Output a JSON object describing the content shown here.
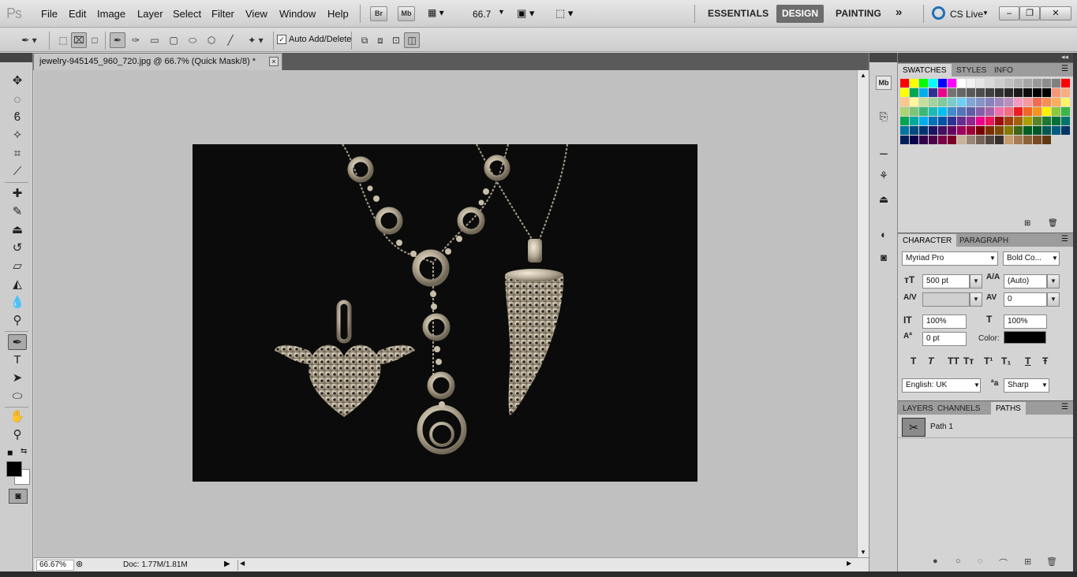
{
  "app": {
    "logo": "Ps",
    "menus": [
      "File",
      "Edit",
      "Image",
      "Layer",
      "Select",
      "Filter",
      "View",
      "Window",
      "Help"
    ],
    "bridge_label": "Br",
    "minibridge_label": "Mb",
    "zoom": "66.7",
    "workspaces": {
      "essentials": "ESSENTIALS",
      "design": "DESIGN",
      "painting": "PAINTING",
      "more": "»"
    },
    "cs_live": "CS Live",
    "window_controls": {
      "minimize": "–",
      "restore": "❐",
      "close": "✕"
    }
  },
  "options": {
    "auto_add_delete_label": "Auto Add/Delete",
    "auto_add_delete_checked": "✓"
  },
  "document": {
    "tab_title": "jewelry-945145_960_720.jpg @ 66.7% (Quick Mask/8) *",
    "close": "×"
  },
  "status": {
    "zoom": "66.67%",
    "doc_info": "Doc: 1.77M/1.81M"
  },
  "swatches_panel": {
    "tabs": [
      "SWATCHES",
      "STYLES",
      "INFO"
    ],
    "colors": [
      "#ff0000",
      "#ffff00",
      "#00ff00",
      "#00ffff",
      "#0000ff",
      "#ff00ff",
      "#ffffff",
      "#f2f2f2",
      "#e6e6e6",
      "#d9d9d9",
      "#cccccc",
      "#bfbfbf",
      "#b3b3b3",
      "#a6a6a6",
      "#999999",
      "#8c8c8c",
      "#808080",
      "#ff0000",
      "#ffff00",
      "#00a651",
      "#00aeef",
      "#2e3192",
      "#ec008c",
      "#737373",
      "#666666",
      "#595959",
      "#4d4d4d",
      "#404040",
      "#333333",
      "#262626",
      "#1a1a1a",
      "#0d0d0d",
      "#000000",
      "#000000",
      "#f7977a",
      "#f9ad81",
      "#fdc68a",
      "#fff79a",
      "#c4df9b",
      "#a3d39c",
      "#82ca9d",
      "#7bcdc8",
      "#6ecff6",
      "#7ea7d8",
      "#8493ca",
      "#8882be",
      "#a187be",
      "#bc8dbf",
      "#f49ac2",
      "#f6989d",
      "#f26c4f",
      "#f68e55",
      "#fbaf5d",
      "#fff467",
      "#acd372",
      "#7cc576",
      "#3bb878",
      "#1abbb4",
      "#00bff3",
      "#438ccb",
      "#5574b9",
      "#605ca8",
      "#855fa8",
      "#a763a8",
      "#f06eaa",
      "#f26d7d",
      "#ed1c24",
      "#f26522",
      "#f7941d",
      "#fff200",
      "#8dc73f",
      "#39b54a",
      "#00a651",
      "#00a99d",
      "#00aeef",
      "#0072bc",
      "#0054a6",
      "#2e3192",
      "#662d91",
      "#92278f",
      "#ec008c",
      "#ed145b",
      "#9e0b0f",
      "#a0410d",
      "#a36209",
      "#aba000",
      "#598527",
      "#1a7b30",
      "#007236",
      "#00746b",
      "#0076a3",
      "#004b80",
      "#003471",
      "#1b1464",
      "#440e62",
      "#630460",
      "#9e005d",
      "#9e0039",
      "#790000",
      "#7b2e00",
      "#7d4900",
      "#827b00",
      "#406618",
      "#005e20",
      "#005826",
      "#005952",
      "#005b7f",
      "#003663",
      "#002157",
      "#0d004c",
      "#32004b",
      "#4b0049",
      "#7b0046",
      "#7a0026",
      "#c7b299",
      "#998675",
      "#736357",
      "#534741",
      "#37302d",
      "#c69c6d",
      "#a67c52",
      "#8c6239",
      "#754c24",
      "#603913"
    ]
  },
  "character_panel": {
    "tabs": [
      "CHARACTER",
      "PARAGRAPH"
    ],
    "font_family": "Myriad Pro",
    "font_style": "Bold Co...",
    "font_size": "500 pt",
    "leading": "(Auto)",
    "kerning": "",
    "tracking": "0",
    "vertical_scale": "100%",
    "horizontal_scale": "100%",
    "baseline_shift": "0 pt",
    "color_label": "Color:",
    "color_value": "#000000",
    "type_buttons": [
      "T",
      "T",
      "TT",
      "Tт",
      "T¹",
      "T₁",
      "T",
      "Ŧ"
    ],
    "language": "English: UK",
    "aa_label": "ªa",
    "antialias": "Sharp"
  },
  "paths_panel": {
    "tabs": [
      "LAYERS",
      "CHANNELS",
      "PATHS"
    ],
    "path_name": "Path 1"
  }
}
